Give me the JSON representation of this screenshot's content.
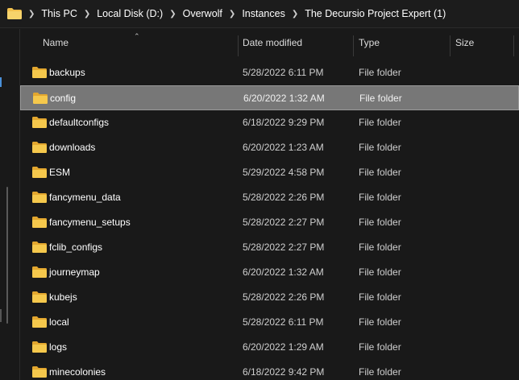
{
  "breadcrumb": {
    "items": [
      "This PC",
      "Local Disk (D:)",
      "Overwolf",
      "Instances",
      "The Decursio Project Expert (1)"
    ]
  },
  "columns": {
    "name": "Name",
    "date_modified": "Date modified",
    "type": "Type",
    "size": "Size"
  },
  "colors": {
    "background": "#191919",
    "selected_row": "#777777",
    "folder_yellow": "#f2c14e"
  },
  "icons": {
    "row_icon": "folder-icon",
    "separator": "chevron-right-icon",
    "sort": "sort-ascending-icon"
  },
  "files": [
    {
      "name": "backups",
      "date": "5/28/2022 6:11 PM",
      "type": "File folder",
      "selected": false
    },
    {
      "name": "config",
      "date": "6/20/2022 1:32 AM",
      "type": "File folder",
      "selected": true
    },
    {
      "name": "defaultconfigs",
      "date": "6/18/2022 9:29 PM",
      "type": "File folder",
      "selected": false
    },
    {
      "name": "downloads",
      "date": "6/20/2022 1:23 AM",
      "type": "File folder",
      "selected": false
    },
    {
      "name": "ESM",
      "date": "5/29/2022 4:58 PM",
      "type": "File folder",
      "selected": false
    },
    {
      "name": "fancymenu_data",
      "date": "5/28/2022 2:26 PM",
      "type": "File folder",
      "selected": false
    },
    {
      "name": "fancymenu_setups",
      "date": "5/28/2022 2:27 PM",
      "type": "File folder",
      "selected": false
    },
    {
      "name": "fclib_configs",
      "date": "5/28/2022 2:27 PM",
      "type": "File folder",
      "selected": false
    },
    {
      "name": "journeymap",
      "date": "6/20/2022 1:32 AM",
      "type": "File folder",
      "selected": false
    },
    {
      "name": "kubejs",
      "date": "5/28/2022 2:26 PM",
      "type": "File folder",
      "selected": false
    },
    {
      "name": "local",
      "date": "5/28/2022 6:11 PM",
      "type": "File folder",
      "selected": false
    },
    {
      "name": "logs",
      "date": "6/20/2022 1:29 AM",
      "type": "File folder",
      "selected": false
    },
    {
      "name": "minecolonies",
      "date": "6/18/2022 9:42 PM",
      "type": "File folder",
      "selected": false
    }
  ]
}
